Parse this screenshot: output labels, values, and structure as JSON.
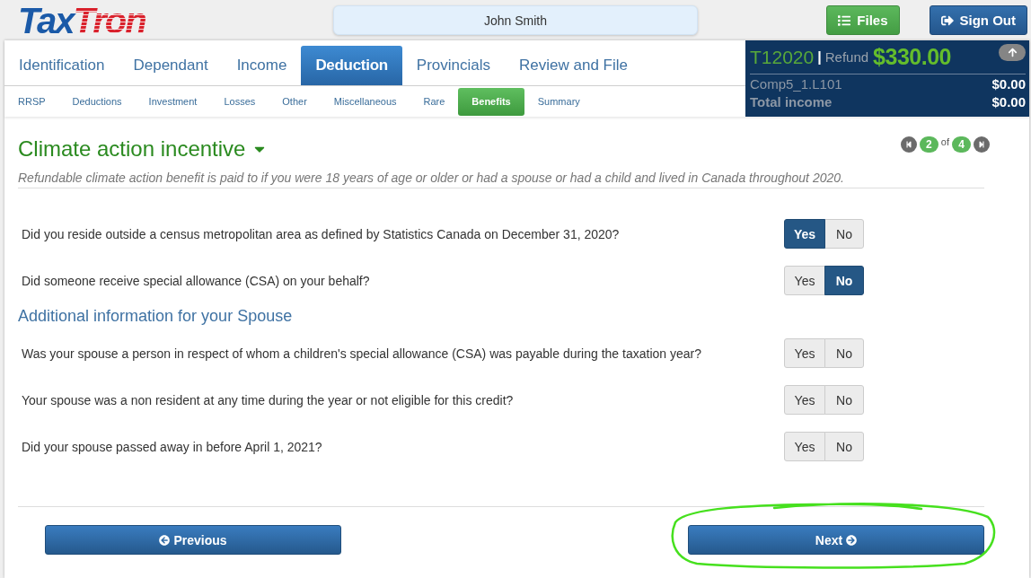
{
  "header": {
    "logo": {
      "part_1": "Tax",
      "part_2": "Tron"
    },
    "client_name": "John Smith",
    "buttons": [
      {
        "label": "Files",
        "kind": "files"
      },
      {
        "label": "Sign Out",
        "kind": "sign_out"
      }
    ]
  },
  "tabs": [
    {
      "label": "Identification",
      "selected": false
    },
    {
      "label": "Dependant",
      "selected": false
    },
    {
      "label": "Income",
      "selected": false
    },
    {
      "label": "Deduction",
      "selected": true
    },
    {
      "label": "Provincials",
      "selected": false
    },
    {
      "label": "Review and File",
      "selected": false
    }
  ],
  "subtabs": [
    {
      "label": "RRSP",
      "selected": false
    },
    {
      "label": "Deductions",
      "selected": false
    },
    {
      "label": "Investment",
      "selected": false
    },
    {
      "label": "Losses",
      "selected": false
    },
    {
      "label": "Other",
      "selected": false
    },
    {
      "label": "Miscellaneous",
      "selected": false
    },
    {
      "label": "Rare",
      "selected": false
    },
    {
      "label": "Benefits",
      "selected": true
    },
    {
      "label": "Summary",
      "selected": false
    }
  ],
  "summary": {
    "return": "T12020",
    "separator": "|",
    "refund_label": "Refund",
    "refund": "$330.00",
    "lines": [
      {
        "label": "Comp5_1.L101",
        "value": "$0.00",
        "emphasis": false
      },
      {
        "label": "Total income",
        "value": "$0.00",
        "emphasis": true
      }
    ]
  },
  "page": {
    "title": "Climate action incentive",
    "pager": {
      "current": "2",
      "of": "of",
      "total": "4"
    },
    "description": "Refundable climate action benefit is paid to if you were 18 years of age or older or had a spouse or had a child and lived in Canada throughout 2020.",
    "sections": [
      {
        "questions": [
          {
            "text": "Did you reside outside a census metropolitan area as defined by Statistics Canada on December 31, 2020?",
            "answers": [
              {
                "label": "Yes",
                "selected": true
              },
              {
                "label": "No",
                "selected": false
              }
            ]
          },
          {
            "text": "Did someone receive special allowance (CSA) on your behalf?",
            "answers": [
              {
                "label": "Yes",
                "selected": false
              },
              {
                "label": "No",
                "selected": true
              }
            ]
          }
        ]
      },
      {
        "heading": "Additional information for your Spouse",
        "questions": [
          {
            "text": "Was your spouse a person in respect of whom a children's special allowance (CSA) was payable during the taxation year?",
            "answers": [
              {
                "label": "Yes",
                "selected": false
              },
              {
                "label": "No",
                "selected": false
              }
            ]
          },
          {
            "text": "Your spouse was a non resident at any time during the year or not eligible for this credit?",
            "answers": [
              {
                "label": "Yes",
                "selected": false
              },
              {
                "label": "No",
                "selected": false
              }
            ]
          },
          {
            "text": "Did your spouse passed away in before April 1, 2021?",
            "answers": [
              {
                "label": "Yes",
                "selected": false
              },
              {
                "label": "No",
                "selected": false
              }
            ]
          }
        ]
      }
    ]
  },
  "footer": {
    "buttons": [
      {
        "label": "Previous",
        "kind": "previous",
        "highlighted": false
      },
      {
        "label": "Next",
        "kind": "next",
        "highlighted": true
      }
    ]
  }
}
